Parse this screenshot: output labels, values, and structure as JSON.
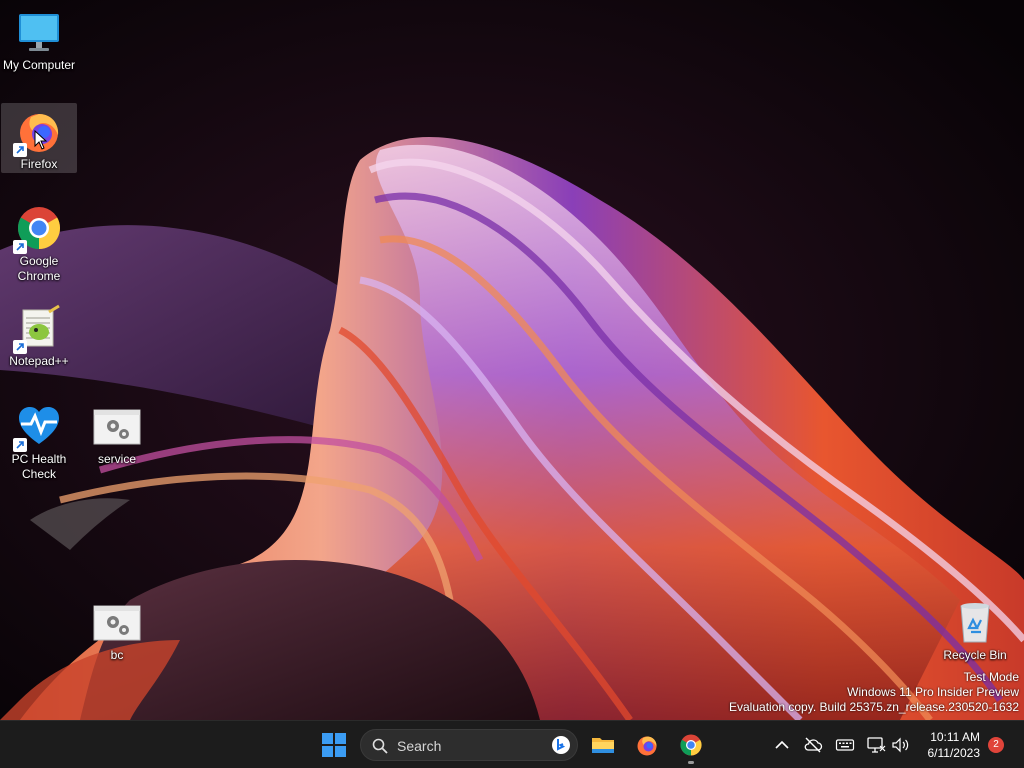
{
  "desktop": {
    "icons": [
      {
        "label": "My Computer",
        "icon": "monitor-icon"
      },
      {
        "label": "Firefox",
        "icon": "firefox-icon",
        "shortcut": true,
        "selected": true
      },
      {
        "label": "Google Chrome",
        "icon": "chrome-icon",
        "shortcut": true
      },
      {
        "label": "Notepad++",
        "icon": "notepad-plus-plus-icon",
        "shortcut": true
      },
      {
        "label": "PC Health Check",
        "icon": "pc-health-check-icon",
        "shortcut": true
      },
      {
        "label": "service",
        "icon": "settings-file-icon"
      },
      {
        "label": "bc",
        "icon": "settings-file-icon"
      },
      {
        "label": "Recycle Bin",
        "icon": "recycle-bin-icon"
      }
    ]
  },
  "watermark": {
    "line1": "Test Mode",
    "line2": "Windows 11 Pro Insider Preview",
    "line3": "Evaluation copy. Build 25375.zn_release.230520-1632"
  },
  "taskbar": {
    "start_icon": "windows-start-icon",
    "search_placeholder": "Search",
    "pinned": [
      {
        "name": "file-explorer",
        "icon": "folder-icon"
      },
      {
        "name": "firefox",
        "icon": "firefox-icon"
      },
      {
        "name": "chrome",
        "icon": "chrome-icon",
        "running": true
      }
    ],
    "tray": {
      "icons": [
        "chevron-up-icon",
        "cloud-offline-icon",
        "keyboard-icon",
        "network-icon",
        "volume-icon"
      ],
      "time": "10:11 AM",
      "date": "6/11/2023",
      "notification_count": "2"
    }
  },
  "colors": {
    "taskbar_bg": "#1c1c1c",
    "accent_blue": "#3b9cf3",
    "badge_red": "#e0443a"
  }
}
